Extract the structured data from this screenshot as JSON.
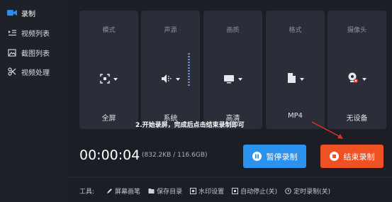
{
  "sidebar": {
    "items": [
      {
        "label": "录制",
        "icon": "video-camera-icon",
        "active": true
      },
      {
        "label": "视频列表",
        "icon": "video-list-icon",
        "active": false
      },
      {
        "label": "截图列表",
        "icon": "image-list-icon",
        "active": false
      },
      {
        "label": "视频处理",
        "icon": "video-tools-icon",
        "active": false
      }
    ]
  },
  "cards": [
    {
      "title": "模式",
      "value": "全屏",
      "icon": "fullscreen-icon"
    },
    {
      "title": "声源",
      "value": "系统",
      "icon": "speaker-icon"
    },
    {
      "title": "画质",
      "value": "高清",
      "icon": "monitor-icon"
    },
    {
      "title": "格式",
      "value": "MP4",
      "icon": "file-icon"
    },
    {
      "title": "摄像头",
      "value": "无设备",
      "icon": "webcam-icon"
    }
  ],
  "annotation": "2.开始录屏，完成后点击结束录制即可",
  "recording": {
    "timer": "00:00:04",
    "size": "(832.2KB / 116.6GB)"
  },
  "buttons": {
    "pause_label": "暂停录制",
    "stop_label": "结束录制"
  },
  "toolbar": {
    "label": "工具:",
    "items": [
      {
        "label": "屏幕画笔",
        "icon": "pen-icon"
      },
      {
        "label": "保存目录",
        "icon": "save-icon"
      },
      {
        "label": "水印设置",
        "icon": "watermark-icon"
      },
      {
        "label": "自动停止(关)",
        "icon": "auto-stop-icon"
      },
      {
        "label": "定时录制(关)",
        "icon": "clock-icon"
      }
    ]
  },
  "colors": {
    "accent": "#2d8cf0",
    "pause": "#2b93ef",
    "stop": "#ef5125",
    "annotation_arrow": "#e03030"
  }
}
